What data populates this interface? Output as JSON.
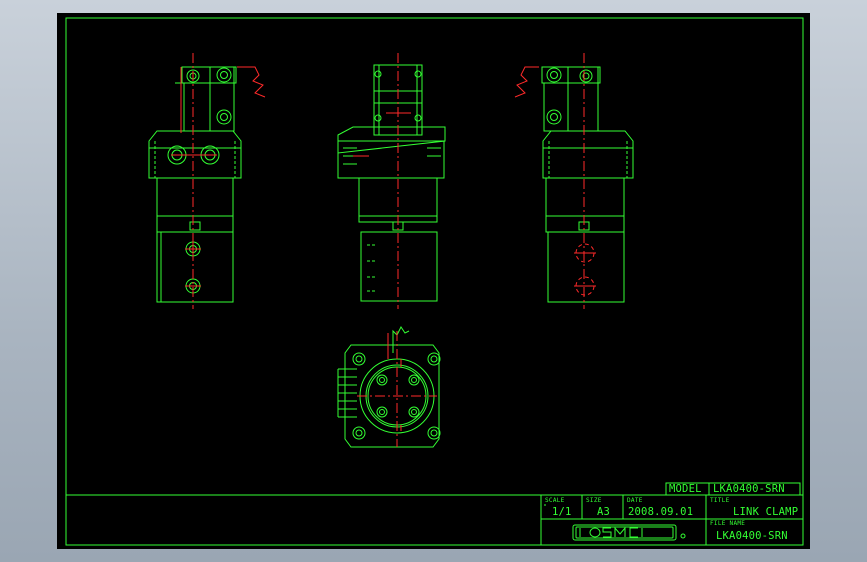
{
  "title_block": {
    "model_label": "MODEL",
    "model_value": "LKA0400-SRN",
    "scale_label": "SCALE",
    "scale_value": "1/1",
    "size_label": "SIZE",
    "size_value": "A3",
    "date_label": "DATE",
    "date_value": "2008.09.01",
    "title_label": "TITLE",
    "title_value": "LINK CLAMP",
    "file_name_label": "FILE NAME",
    "file_name_value": "LKA0400-SRN",
    "company_logo": "KOSMEK"
  },
  "colors": {
    "background": "#000000",
    "line_primary": "#33ff33",
    "line_center": "#ff2a2a",
    "line_hidden": "#2ecc2e",
    "viewport_frame": "#a9b4c0"
  }
}
